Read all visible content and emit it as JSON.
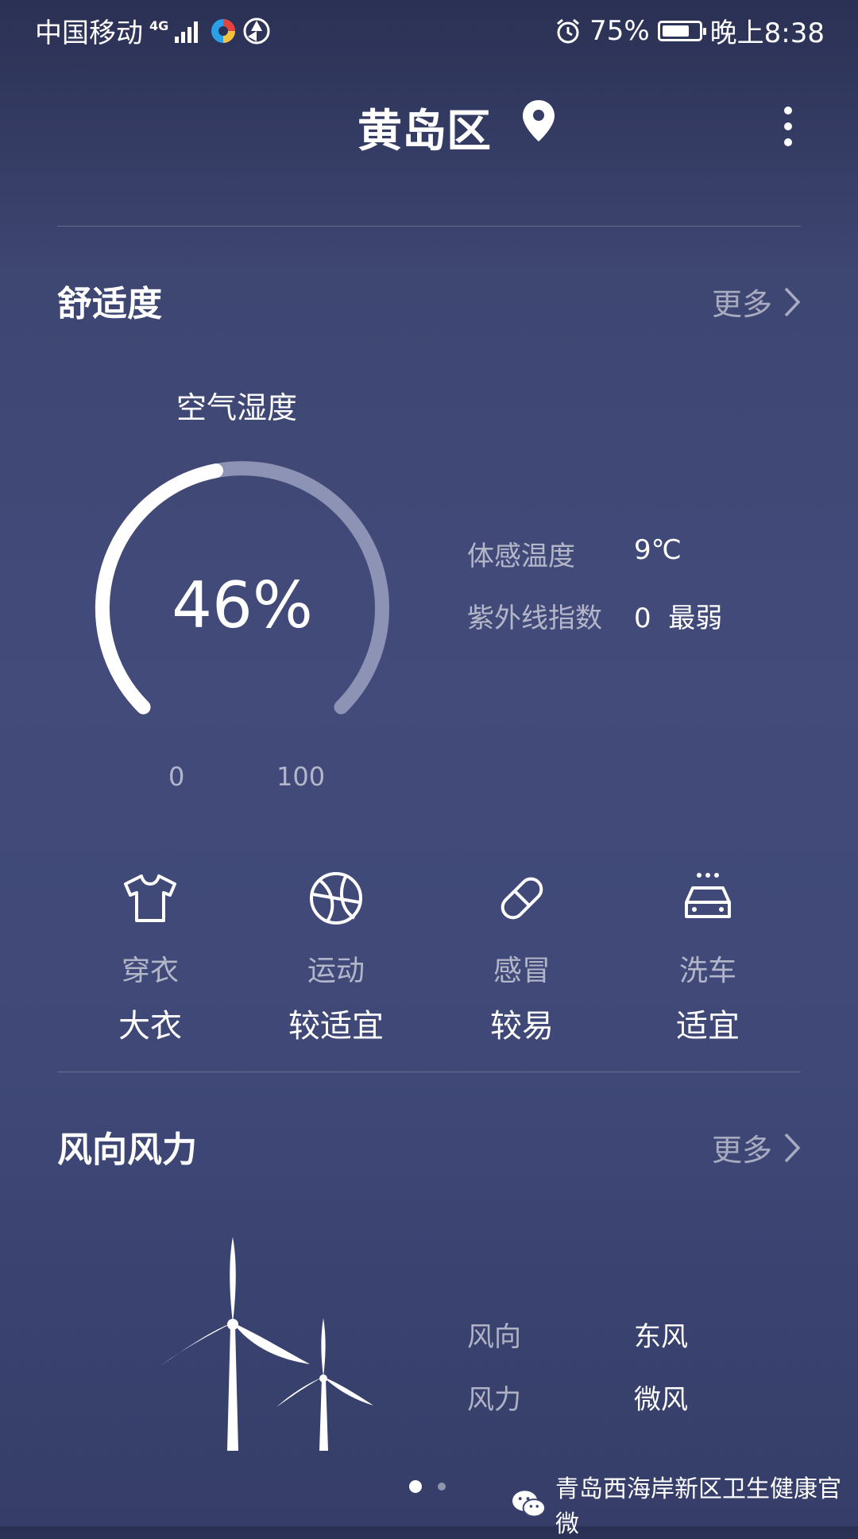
{
  "status_bar": {
    "carrier": "中国移动",
    "network": "4G",
    "battery_percent": "75%",
    "battery_level": 0.75,
    "time": "晚上8:38",
    "alarm_icon": "alarm-clock-icon"
  },
  "header": {
    "location": "黄岛区",
    "location_icon": "map-pin-icon",
    "menu_icon": "more-vertical-icon"
  },
  "comfort": {
    "title": "舒适度",
    "more_label": "更多",
    "humidity": {
      "label": "空气湿度",
      "value_text": "46%",
      "value": 46,
      "min_label": "0",
      "max_label": "100"
    },
    "details": [
      {
        "label": "体感温度",
        "value": "9℃"
      },
      {
        "label": "紫外线指数",
        "value": "0  最弱"
      }
    ],
    "indices": [
      {
        "icon": "tshirt-icon",
        "label": "穿衣",
        "value": "大衣"
      },
      {
        "icon": "ball-icon",
        "label": "运动",
        "value": "较适宜"
      },
      {
        "icon": "pill-icon",
        "label": "感冒",
        "value": "较易"
      },
      {
        "icon": "car-wash-icon",
        "label": "洗车",
        "value": "适宜"
      }
    ]
  },
  "wind": {
    "title": "风向风力",
    "more_label": "更多",
    "direction_label": "风向",
    "direction_value": "东风",
    "force_label": "风力",
    "force_value": "微风"
  },
  "pager": {
    "pages": 2,
    "active": 1
  },
  "watermark": {
    "text": "青岛西海岸新区卫生健康官微",
    "icon": "wechat-icon"
  },
  "colors": {
    "arc_track": "#8d93b4",
    "arc_fill": "#ffffff",
    "muted_text": "#a3a8c4"
  }
}
